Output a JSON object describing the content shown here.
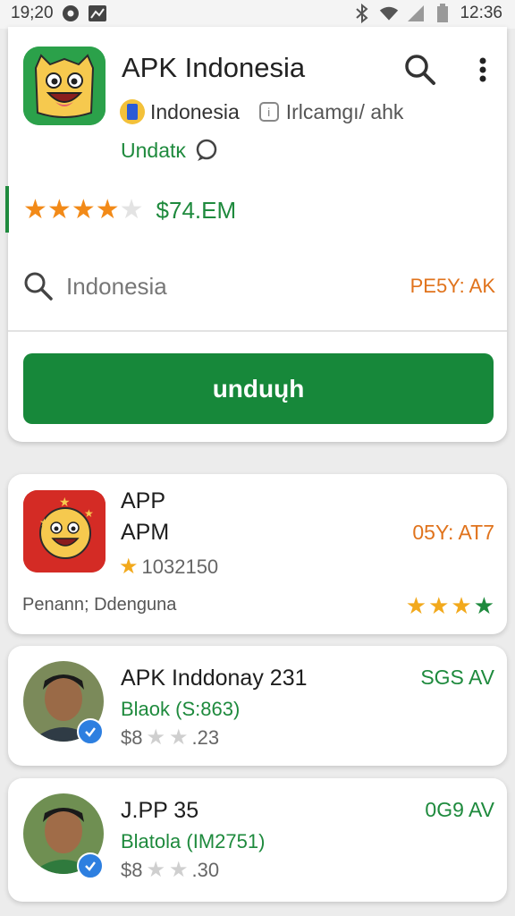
{
  "status_bar": {
    "time_left": "19;20",
    "time_right": "12:36"
  },
  "app": {
    "title": "APK Indonesia",
    "country": "Indonesia",
    "subtitle": "Irlcamgı/ ahk",
    "update_label": "Undatĸ",
    "price": "$74.EM",
    "rating_stars": 4,
    "search_text": "Indonesia",
    "search_right": "PE5Y: AK",
    "download_label": "unduųh"
  },
  "list": [
    {
      "name_line1": "APP",
      "name_line2": "APM",
      "right": "05Y: AT7",
      "rating_count": "1032150",
      "footer": "Penann; Ddenguna",
      "stars": 4
    },
    {
      "name": "APK Inddonay 231",
      "right": "SGS AV",
      "sub": "Blaok (S:863)",
      "price": "$8",
      "meta_tail": ".23"
    },
    {
      "name": "J.PP 35",
      "right": "0G9 AV",
      "sub": "Blatola (IM2751)",
      "price": "$8",
      "meta_tail": ".30"
    }
  ],
  "icons": [
    "record-icon",
    "trend-icon",
    "bluetooth-icon",
    "wifi-icon",
    "signal-icon",
    "battery-icon",
    "search-icon",
    "more-vert-icon",
    "info-icon",
    "chat-icon",
    "star-icon",
    "verified-icon"
  ],
  "colors": {
    "primary_green": "#17883a",
    "accent_orange": "#e0731c",
    "star_orange": "#f28a18"
  }
}
